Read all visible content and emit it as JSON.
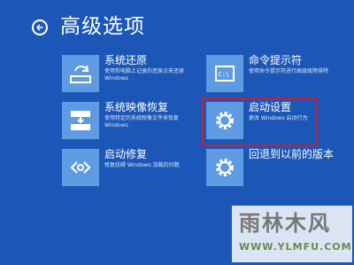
{
  "header": {
    "title": "高级选项"
  },
  "options": {
    "system_restore": {
      "label": "系统还原",
      "description": "使用你电脑上记录的还原点来还原 Windows"
    },
    "system_image_recovery": {
      "label": "系统映像恢复",
      "description": "使用特定的系统映像文件来恢复 Windows"
    },
    "startup_repair": {
      "label": "启动修复",
      "description": "修复妨碍 Windows 加载的问题"
    },
    "command_prompt": {
      "label": "命令提示符",
      "description": "使用命令提示符进行高级故障排除"
    },
    "startup_settings": {
      "label": "启动设置",
      "description": "更改 Windows 启动行为"
    },
    "go_back": {
      "label": "回退到以前的版本",
      "description": ""
    }
  },
  "watermark": {
    "name": "雨林木风",
    "url": "WWW.YLMFU.COM"
  },
  "colors": {
    "background": "#1c57b8",
    "tile": "#5e9be2",
    "highlight": "#c42034"
  }
}
